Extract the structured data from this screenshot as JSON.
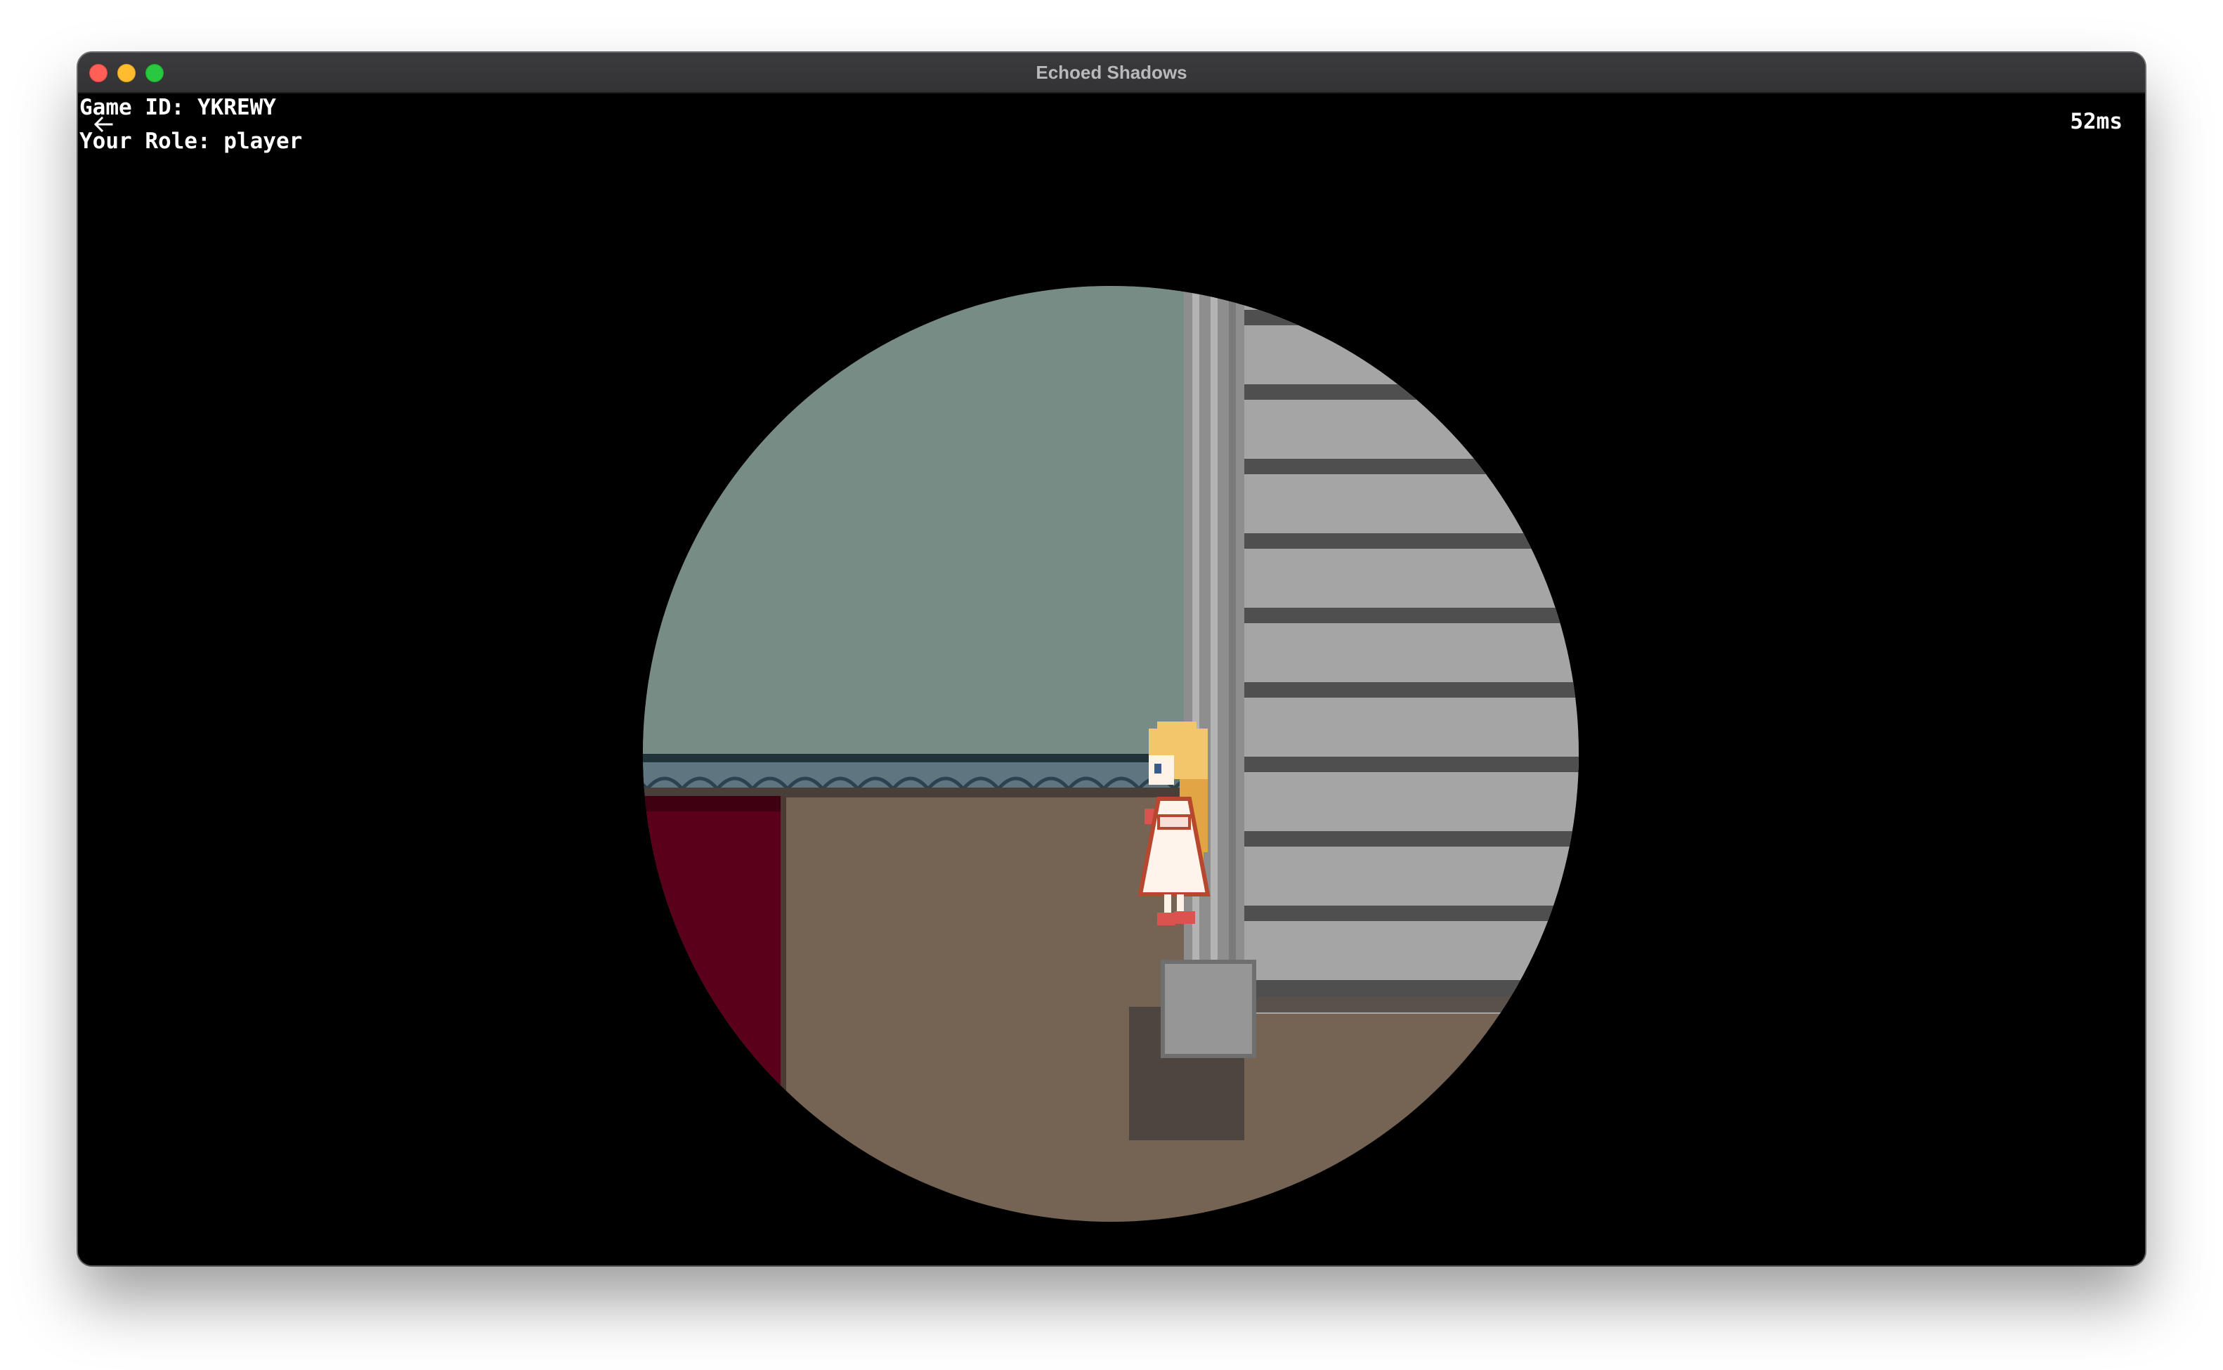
{
  "window": {
    "title": "Echoed Shadows"
  },
  "hud": {
    "game_id": "Game ID: YKREWY",
    "role": "Your Role: player",
    "ping": "52ms"
  },
  "icons": {
    "back": "back-arrow-icon"
  },
  "colors": {
    "wall": "#788c86",
    "floor": "#756354",
    "curtain": "#5a001a",
    "stairs": "#a5a5a5",
    "stair_edge": "#4f4f4f",
    "pillar": "#9a9a9a",
    "background": "#000000"
  }
}
